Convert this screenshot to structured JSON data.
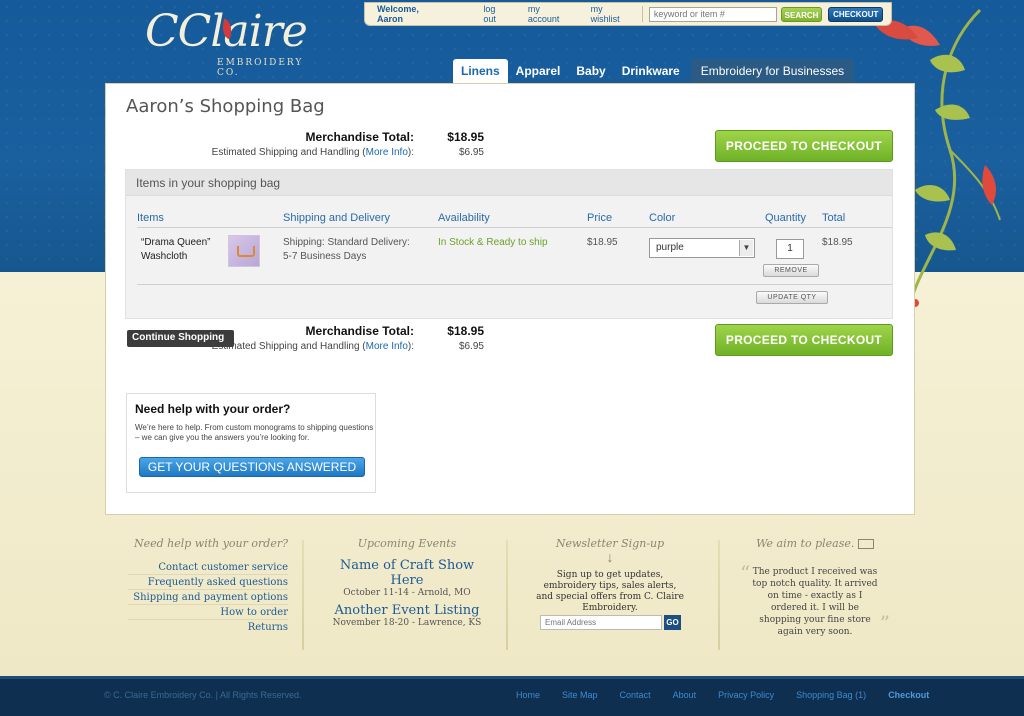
{
  "brand": {
    "name_script": "Claire",
    "tagline": "EMBROIDERY CO."
  },
  "topbar": {
    "welcome": "Welcome, Aaron",
    "logout": "log out",
    "account": "my account",
    "wishlist": "my wishlist",
    "search_placeholder": "keyword or item #",
    "search_btn": "SEARCH",
    "checkout_btn": "CHECKOUT"
  },
  "tabs": [
    {
      "label": "Linens"
    },
    {
      "label": "Apparel"
    },
    {
      "label": "Baby"
    },
    {
      "label": "Drinkware"
    },
    {
      "label": "Embroidery for Businesses"
    }
  ],
  "bag": {
    "title": "Aaron’s Shopping Bag",
    "merch_label": "Merchandise Total:",
    "merch_value": "$18.95",
    "ship_label_pre": "Estimated Shipping and Handling (",
    "ship_link": "More Info",
    "ship_label_post": "):",
    "ship_value": "$6.95",
    "proceed_btn": "PROCEED TO CHECKOUT",
    "items_heading": "Items in your shopping bag",
    "columns": {
      "items": "Items",
      "shipping": "Shipping and Delivery",
      "availability": "Availability",
      "price": "Price",
      "color": "Color",
      "quantity": "Quantity",
      "total": "Total"
    },
    "item": {
      "name_line1": "“Drama Queen”",
      "name_line2": "Washcloth",
      "shipping_line1": "Shipping: Standard Delivery:",
      "shipping_line2": "5-7 Business Days",
      "availability": "In Stock & Ready to ship",
      "price": "$18.95",
      "color": "purple",
      "quantity": "1",
      "total": "$18.95",
      "remove_btn": "REMOVE"
    },
    "update_btn": "UPDATE QTY",
    "continue_btn": "Continue Shopping ⌄"
  },
  "help": {
    "title": "Need help with your order?",
    "text": "We’re here to help.  From custom monograms to shipping questions – we can give you the answers you’re looking for.",
    "button": "GET YOUR QUESTIONS ANSWERED"
  },
  "footer_cols": {
    "help_heading": "Need help with your order?",
    "links": [
      "Contact customer service",
      "Frequently asked questions",
      "Shipping and payment options",
      "How to order",
      "Returns"
    ],
    "events_heading": "Upcoming Events",
    "events": [
      {
        "title": "Name of Craft Show Here",
        "sub": "October 11-14 - Arnold, MO"
      },
      {
        "title": "Another Event Listing",
        "sub": "November 18-20 - Lawrence, KS"
      }
    ],
    "newsletter_heading": "Newsletter Sign-up",
    "newsletter_text": "Sign up to get updates, embroidery tips, sales alerts, and special offers from  C. Claire Embroidery.",
    "email_placeholder": "Email Address",
    "go_btn": "GO",
    "quote_heading": "We aim to please.",
    "quote_text": "The product I received was top notch quality. It arrived on time - exactly as I ordered it. I will be shopping your fine store again very soon."
  },
  "footer": {
    "copyright": "© C. Claire Embroidery Co. | All Rights Reserved.",
    "nav": [
      "Home",
      "Site Map",
      "Contact",
      "About",
      "Privacy Policy",
      "Shopping Bag (1)",
      "Checkout"
    ]
  },
  "colors": {
    "header_blue": "#155a9a",
    "accent_green": "#7fb32c",
    "link_blue": "#1a6aaa",
    "footer_navy": "#0e2f4f"
  }
}
